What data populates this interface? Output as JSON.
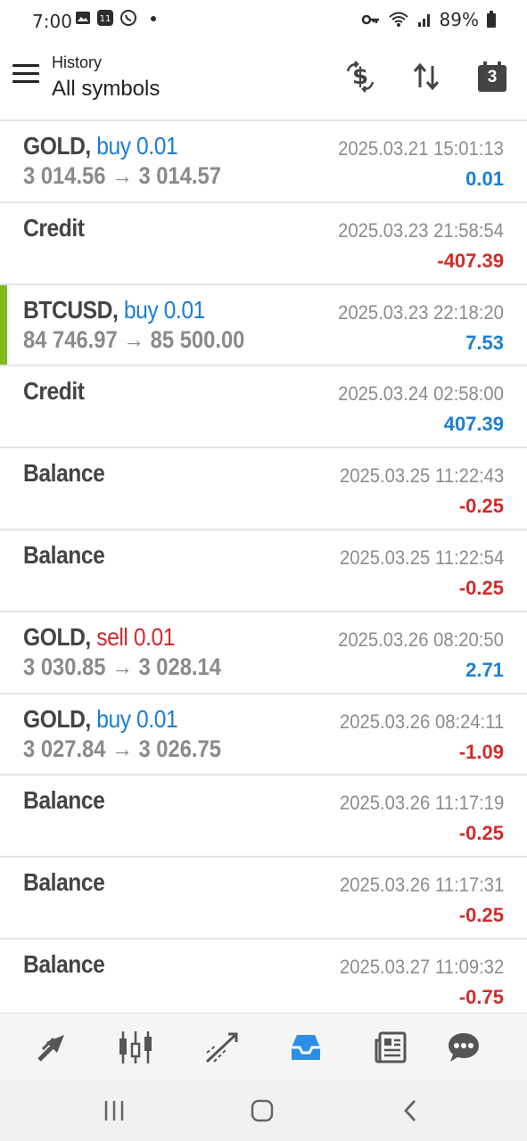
{
  "status_bar": {
    "time": "7:00",
    "battery": "89%",
    "icons_left": [
      "gallery-icon",
      "app-icon",
      "whatsapp-icon",
      "dot-icon"
    ],
    "icons_right": [
      "key-icon",
      "wifi-icon",
      "signal-icon",
      "battery-icon"
    ]
  },
  "toolbar": {
    "title": "History",
    "subtitle": "All symbols",
    "calendar_day": "3"
  },
  "rows": [
    {
      "symbol": "GOLD,",
      "type": "buy 0.01",
      "type_class": "buy",
      "prices": "3 014.56 → 3 014.57",
      "time": "2025.03.21 15:01:13",
      "pl": "0.01",
      "pl_sign": "pos",
      "accent": false
    },
    {
      "symbol": "Credit",
      "type": "",
      "type_class": "",
      "prices": "",
      "time": "2025.03.23 21:58:54",
      "pl": "-407.39",
      "pl_sign": "neg",
      "accent": false
    },
    {
      "symbol": "BTCUSD,",
      "type": "buy 0.01",
      "type_class": "buy",
      "prices": "84 746.97 → 85 500.00",
      "time": "2025.03.23 22:18:20",
      "pl": "7.53",
      "pl_sign": "pos",
      "accent": true
    },
    {
      "symbol": "Credit",
      "type": "",
      "type_class": "",
      "prices": "",
      "time": "2025.03.24 02:58:00",
      "pl": "407.39",
      "pl_sign": "pos",
      "accent": false
    },
    {
      "symbol": "Balance",
      "type": "",
      "type_class": "",
      "prices": "",
      "time": "2025.03.25 11:22:43",
      "pl": "-0.25",
      "pl_sign": "neg",
      "accent": false
    },
    {
      "symbol": "Balance",
      "type": "",
      "type_class": "",
      "prices": "",
      "time": "2025.03.25 11:22:54",
      "pl": "-0.25",
      "pl_sign": "neg",
      "accent": false
    },
    {
      "symbol": "GOLD,",
      "type": "sell 0.01",
      "type_class": "sell",
      "prices": "3 030.85 → 3 028.14",
      "time": "2025.03.26 08:20:50",
      "pl": "2.71",
      "pl_sign": "pos",
      "accent": false
    },
    {
      "symbol": "GOLD,",
      "type": "buy 0.01",
      "type_class": "buy",
      "prices": "3 027.84 → 3 026.75",
      "time": "2025.03.26 08:24:11",
      "pl": "-1.09",
      "pl_sign": "neg",
      "accent": false
    },
    {
      "symbol": "Balance",
      "type": "",
      "type_class": "",
      "prices": "",
      "time": "2025.03.26 11:17:19",
      "pl": "-0.25",
      "pl_sign": "neg",
      "accent": false
    },
    {
      "symbol": "Balance",
      "type": "",
      "type_class": "",
      "prices": "",
      "time": "2025.03.26 11:17:31",
      "pl": "-0.25",
      "pl_sign": "neg",
      "accent": false
    },
    {
      "symbol": "Balance",
      "type": "",
      "type_class": "",
      "prices": "",
      "time": "2025.03.27 11:09:32",
      "pl": "-0.75",
      "pl_sign": "neg",
      "accent": false
    }
  ],
  "bottom_nav": {
    "items": [
      "quotes-icon",
      "chart-icon",
      "trade-icon",
      "history-icon",
      "news-icon",
      "messages-icon"
    ],
    "active": "history-icon",
    "active_color": "#2b8fe6"
  },
  "colors": {
    "buy": "#1a7fd4",
    "sell": "#d32a2a",
    "accent": "#7fba1f"
  }
}
